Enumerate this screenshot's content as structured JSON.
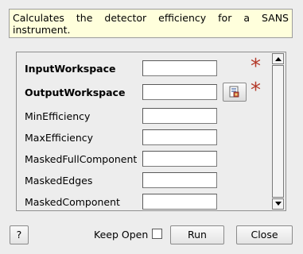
{
  "description": "Calculates the detector efficiency for a SANS instrument.",
  "properties": [
    {
      "label": "InputWorkspace",
      "required": true,
      "value": "",
      "browse": false
    },
    {
      "label": "OutputWorkspace",
      "required": true,
      "value": "",
      "browse": true
    },
    {
      "label": "MinEfficiency",
      "required": false,
      "value": "",
      "browse": false
    },
    {
      "label": "MaxEfficiency",
      "required": false,
      "value": "",
      "browse": false
    },
    {
      "label": "MaskedFullComponent",
      "required": false,
      "value": "",
      "browse": false
    },
    {
      "label": "MaskedEdges",
      "required": false,
      "value": "",
      "browse": false
    },
    {
      "label": "MaskedComponent",
      "required": false,
      "value": "",
      "browse": false
    }
  ],
  "required_marker": "*",
  "buttons": {
    "help_label": "?",
    "keep_open_label": "Keep Open",
    "keep_open_checked": false,
    "run_label": "Run",
    "close_label": "Close"
  },
  "colors": {
    "required_star": "#b43a2a",
    "description_bg": "#ffffdc"
  },
  "icons": {
    "browse": "browse-workspace-icon",
    "scroll_up": "arrow-up-icon",
    "scroll_down": "arrow-down-icon"
  }
}
